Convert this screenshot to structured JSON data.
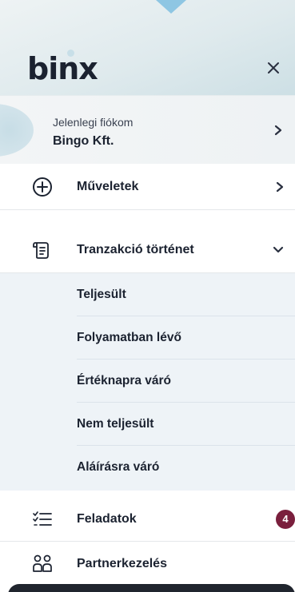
{
  "brand": {
    "logo_text": "binx"
  },
  "account": {
    "caption": "Jelenlegi fiókom",
    "name": "Bingo Kft."
  },
  "menu": {
    "muveletek": {
      "label": "Műveletek",
      "icon": "plus-circle-icon"
    },
    "tranzakcio": {
      "label": "Tranzakció történet",
      "icon": "transaction-history-icon"
    },
    "submenu": [
      {
        "label": "Teljesült"
      },
      {
        "label": "Folyamatban lévő"
      },
      {
        "label": "Értéknapra váró"
      },
      {
        "label": "Nem teljesült"
      },
      {
        "label": "Aláírásra váró"
      }
    ],
    "feladatok": {
      "label": "Feladatok",
      "icon": "task-list-icon",
      "badge": "4"
    },
    "partnerkezeles": {
      "label": "Partnerkezelés",
      "icon": "partners-icon"
    }
  },
  "colors": {
    "accent_pointer": "#8ec6e3",
    "badge": "#7a1f3d",
    "submenu_bg": "#eef3f7",
    "text": "#1b2230"
  }
}
